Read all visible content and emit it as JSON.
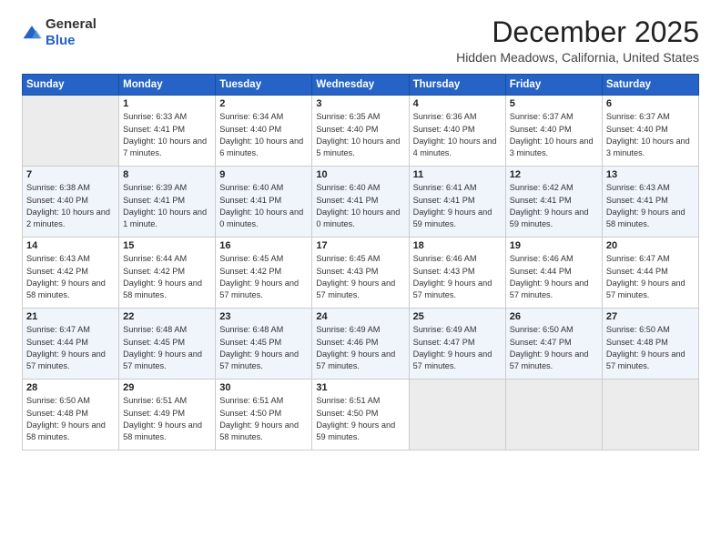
{
  "logo": {
    "general": "General",
    "blue": "Blue"
  },
  "header": {
    "month": "December 2025",
    "location": "Hidden Meadows, California, United States"
  },
  "weekdays": [
    "Sunday",
    "Monday",
    "Tuesday",
    "Wednesday",
    "Thursday",
    "Friday",
    "Saturday"
  ],
  "weeks": [
    [
      {
        "day": "",
        "empty": true
      },
      {
        "day": "1",
        "sunrise": "Sunrise: 6:33 AM",
        "sunset": "Sunset: 4:41 PM",
        "daylight": "Daylight: 10 hours and 7 minutes."
      },
      {
        "day": "2",
        "sunrise": "Sunrise: 6:34 AM",
        "sunset": "Sunset: 4:40 PM",
        "daylight": "Daylight: 10 hours and 6 minutes."
      },
      {
        "day": "3",
        "sunrise": "Sunrise: 6:35 AM",
        "sunset": "Sunset: 4:40 PM",
        "daylight": "Daylight: 10 hours and 5 minutes."
      },
      {
        "day": "4",
        "sunrise": "Sunrise: 6:36 AM",
        "sunset": "Sunset: 4:40 PM",
        "daylight": "Daylight: 10 hours and 4 minutes."
      },
      {
        "day": "5",
        "sunrise": "Sunrise: 6:37 AM",
        "sunset": "Sunset: 4:40 PM",
        "daylight": "Daylight: 10 hours and 3 minutes."
      },
      {
        "day": "6",
        "sunrise": "Sunrise: 6:37 AM",
        "sunset": "Sunset: 4:40 PM",
        "daylight": "Daylight: 10 hours and 3 minutes."
      }
    ],
    [
      {
        "day": "7",
        "sunrise": "Sunrise: 6:38 AM",
        "sunset": "Sunset: 4:40 PM",
        "daylight": "Daylight: 10 hours and 2 minutes."
      },
      {
        "day": "8",
        "sunrise": "Sunrise: 6:39 AM",
        "sunset": "Sunset: 4:41 PM",
        "daylight": "Daylight: 10 hours and 1 minute."
      },
      {
        "day": "9",
        "sunrise": "Sunrise: 6:40 AM",
        "sunset": "Sunset: 4:41 PM",
        "daylight": "Daylight: 10 hours and 0 minutes."
      },
      {
        "day": "10",
        "sunrise": "Sunrise: 6:40 AM",
        "sunset": "Sunset: 4:41 PM",
        "daylight": "Daylight: 10 hours and 0 minutes."
      },
      {
        "day": "11",
        "sunrise": "Sunrise: 6:41 AM",
        "sunset": "Sunset: 4:41 PM",
        "daylight": "Daylight: 9 hours and 59 minutes."
      },
      {
        "day": "12",
        "sunrise": "Sunrise: 6:42 AM",
        "sunset": "Sunset: 4:41 PM",
        "daylight": "Daylight: 9 hours and 59 minutes."
      },
      {
        "day": "13",
        "sunrise": "Sunrise: 6:43 AM",
        "sunset": "Sunset: 4:41 PM",
        "daylight": "Daylight: 9 hours and 58 minutes."
      }
    ],
    [
      {
        "day": "14",
        "sunrise": "Sunrise: 6:43 AM",
        "sunset": "Sunset: 4:42 PM",
        "daylight": "Daylight: 9 hours and 58 minutes."
      },
      {
        "day": "15",
        "sunrise": "Sunrise: 6:44 AM",
        "sunset": "Sunset: 4:42 PM",
        "daylight": "Daylight: 9 hours and 58 minutes."
      },
      {
        "day": "16",
        "sunrise": "Sunrise: 6:45 AM",
        "sunset": "Sunset: 4:42 PM",
        "daylight": "Daylight: 9 hours and 57 minutes."
      },
      {
        "day": "17",
        "sunrise": "Sunrise: 6:45 AM",
        "sunset": "Sunset: 4:43 PM",
        "daylight": "Daylight: 9 hours and 57 minutes."
      },
      {
        "day": "18",
        "sunrise": "Sunrise: 6:46 AM",
        "sunset": "Sunset: 4:43 PM",
        "daylight": "Daylight: 9 hours and 57 minutes."
      },
      {
        "day": "19",
        "sunrise": "Sunrise: 6:46 AM",
        "sunset": "Sunset: 4:44 PM",
        "daylight": "Daylight: 9 hours and 57 minutes."
      },
      {
        "day": "20",
        "sunrise": "Sunrise: 6:47 AM",
        "sunset": "Sunset: 4:44 PM",
        "daylight": "Daylight: 9 hours and 57 minutes."
      }
    ],
    [
      {
        "day": "21",
        "sunrise": "Sunrise: 6:47 AM",
        "sunset": "Sunset: 4:44 PM",
        "daylight": "Daylight: 9 hours and 57 minutes."
      },
      {
        "day": "22",
        "sunrise": "Sunrise: 6:48 AM",
        "sunset": "Sunset: 4:45 PM",
        "daylight": "Daylight: 9 hours and 57 minutes."
      },
      {
        "day": "23",
        "sunrise": "Sunrise: 6:48 AM",
        "sunset": "Sunset: 4:45 PM",
        "daylight": "Daylight: 9 hours and 57 minutes."
      },
      {
        "day": "24",
        "sunrise": "Sunrise: 6:49 AM",
        "sunset": "Sunset: 4:46 PM",
        "daylight": "Daylight: 9 hours and 57 minutes."
      },
      {
        "day": "25",
        "sunrise": "Sunrise: 6:49 AM",
        "sunset": "Sunset: 4:47 PM",
        "daylight": "Daylight: 9 hours and 57 minutes."
      },
      {
        "day": "26",
        "sunrise": "Sunrise: 6:50 AM",
        "sunset": "Sunset: 4:47 PM",
        "daylight": "Daylight: 9 hours and 57 minutes."
      },
      {
        "day": "27",
        "sunrise": "Sunrise: 6:50 AM",
        "sunset": "Sunset: 4:48 PM",
        "daylight": "Daylight: 9 hours and 57 minutes."
      }
    ],
    [
      {
        "day": "28",
        "sunrise": "Sunrise: 6:50 AM",
        "sunset": "Sunset: 4:48 PM",
        "daylight": "Daylight: 9 hours and 58 minutes."
      },
      {
        "day": "29",
        "sunrise": "Sunrise: 6:51 AM",
        "sunset": "Sunset: 4:49 PM",
        "daylight": "Daylight: 9 hours and 58 minutes."
      },
      {
        "day": "30",
        "sunrise": "Sunrise: 6:51 AM",
        "sunset": "Sunset: 4:50 PM",
        "daylight": "Daylight: 9 hours and 58 minutes."
      },
      {
        "day": "31",
        "sunrise": "Sunrise: 6:51 AM",
        "sunset": "Sunset: 4:50 PM",
        "daylight": "Daylight: 9 hours and 59 minutes."
      },
      {
        "day": "",
        "empty": true
      },
      {
        "day": "",
        "empty": true
      },
      {
        "day": "",
        "empty": true
      }
    ]
  ]
}
